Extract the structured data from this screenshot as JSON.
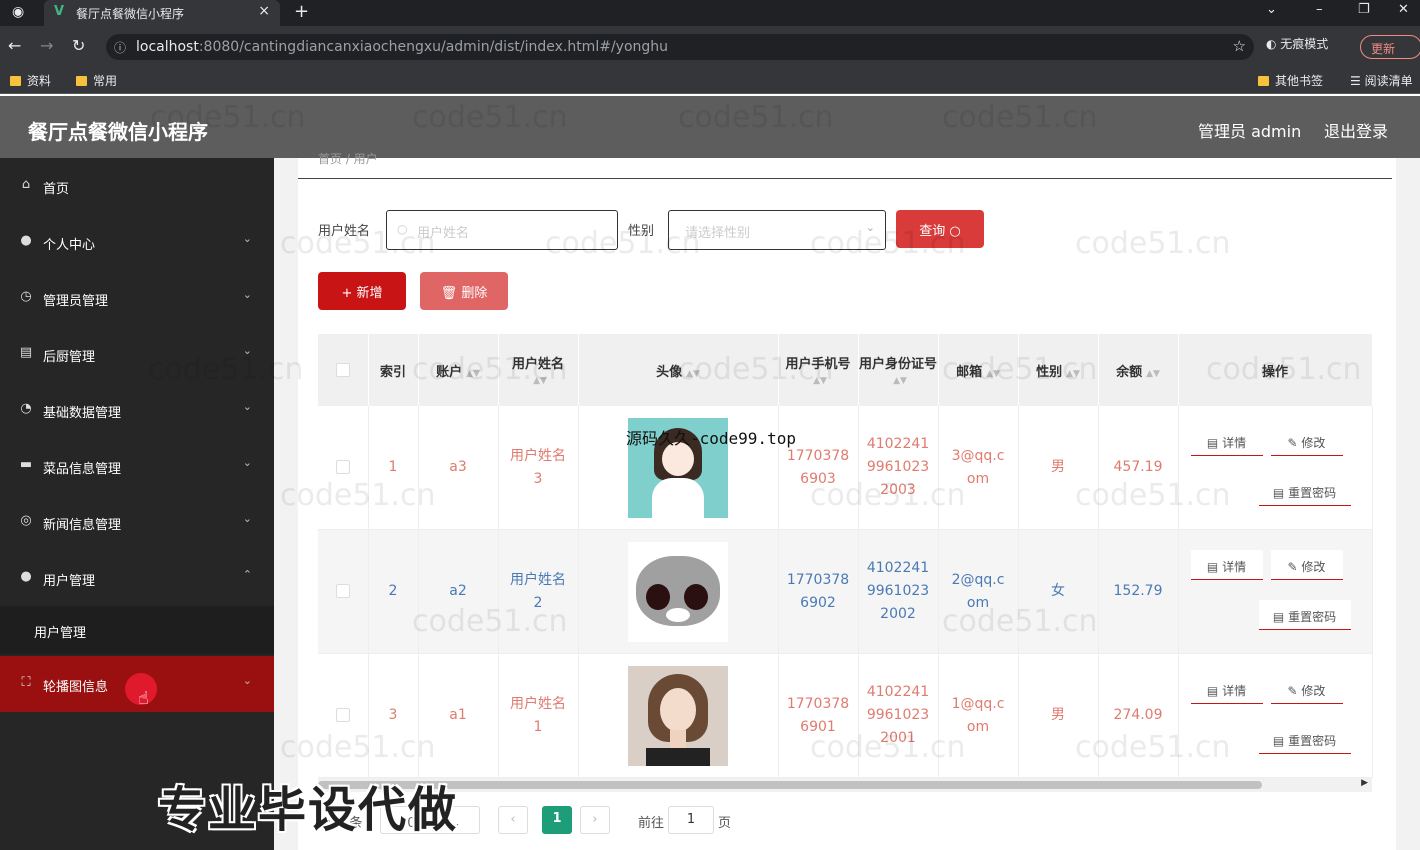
{
  "browser": {
    "tab_title": "餐厅点餐微信小程序",
    "url_host": "localhost",
    "url_rest": ":8080/cantingdiancanxiaochengxu/admin/dist/index.html#/yonghu",
    "incognito_label": "无痕模式",
    "update_label": "更新",
    "bookmarks": [
      "资料",
      "常用"
    ],
    "other_bookmarks": "其他书签",
    "reading_list": "阅读清单"
  },
  "header": {
    "app_title": "餐厅点餐微信小程序",
    "admin_label": "管理员 admin",
    "logout_label": "退出登录"
  },
  "sidebar": {
    "items": [
      {
        "label": "首页",
        "icon": "home-icon"
      },
      {
        "label": "个人中心",
        "icon": "user-icon"
      },
      {
        "label": "管理员管理",
        "icon": "clock-icon"
      },
      {
        "label": "后厨管理",
        "icon": "briefcase-icon"
      },
      {
        "label": "基础数据管理",
        "icon": "gauge-icon"
      },
      {
        "label": "菜品信息管理",
        "icon": "monitor-icon"
      },
      {
        "label": "新闻信息管理",
        "icon": "target-icon"
      },
      {
        "label": "用户管理",
        "icon": "pin-icon"
      },
      {
        "label": "轮播图信息",
        "icon": "frame-icon"
      }
    ],
    "sub_item": "用户管理"
  },
  "breadcrumb": "首页 / 用户",
  "filters": {
    "name_label": "用户姓名",
    "name_placeholder": "用户姓名",
    "gender_label": "性别",
    "gender_placeholder": "请选择性别",
    "search_label": "查询"
  },
  "actions": {
    "add_label": "新增",
    "delete_label": "删除"
  },
  "table": {
    "headers": {
      "index": "索引",
      "account": "账户",
      "name": "用户姓名",
      "avatar": "头像",
      "phone": "用户手机号",
      "idcard": "用户身份证号",
      "email": "邮箱",
      "gender": "性别",
      "balance": "余额",
      "ops": "操作"
    },
    "rows": [
      {
        "index": "1",
        "account": "a3",
        "name": "用户姓名3",
        "phone": "17703786903",
        "idcard": "410224199610232003",
        "email": "3@qq.com",
        "gender": "男",
        "balance": "457.19"
      },
      {
        "index": "2",
        "account": "a2",
        "name": "用户姓名2",
        "phone": "17703786902",
        "idcard": "410224199610232002",
        "email": "2@qq.com",
        "gender": "女",
        "balance": "152.79"
      },
      {
        "index": "3",
        "account": "a1",
        "name": "用户姓名1",
        "phone": "17703786901",
        "idcard": "410224199610232001",
        "email": "1@qq.com",
        "gender": "男",
        "balance": "274.09"
      }
    ],
    "op_detail": "详情",
    "op_edit": "修改",
    "op_reset": "重置密码"
  },
  "pagination": {
    "page_size_prefix": "共 3 条",
    "page_size_value": "10条/页",
    "current_page": "1",
    "goto_label": "前往",
    "goto_value": "1",
    "page_suffix": "页"
  },
  "overlays": {
    "watermark": "code51.cn",
    "top_text": "源码久久-code99.top",
    "big_text": "专业毕设代做"
  }
}
